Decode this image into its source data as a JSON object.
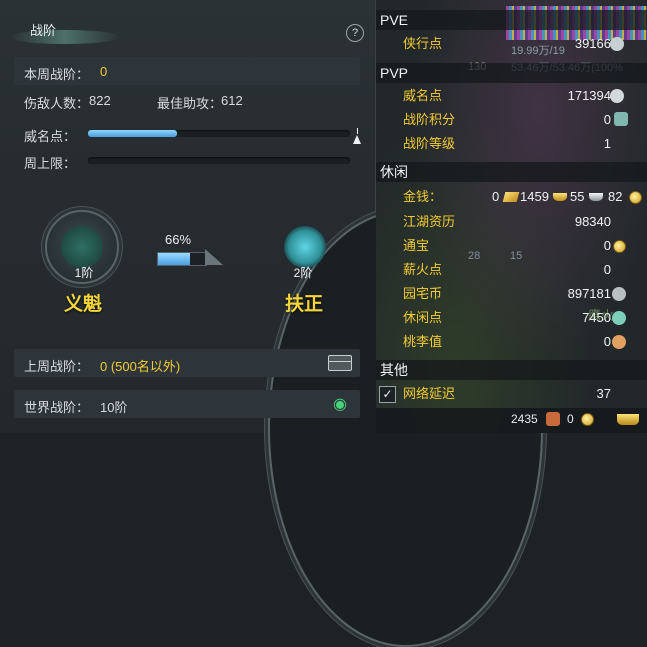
{
  "left_panel": {
    "tab_label": "战阶",
    "help_label": "?",
    "this_week": {
      "label": "本周战阶：",
      "value": "0"
    },
    "enemies": {
      "label": "伤敌人数：",
      "value": "822"
    },
    "best_assist": {
      "label": "最佳助攻：",
      "value": "612"
    },
    "reputation": {
      "label": "威名点：",
      "fill_fraction": 0.34
    },
    "weekly_cap": {
      "label": "周上限：",
      "fill_fraction": 0.0
    },
    "rank_current": {
      "level": "1阶",
      "name": "义魁"
    },
    "rank_next": {
      "level": "2阶",
      "name": "扶正"
    },
    "progress": {
      "text": "66%",
      "fraction": 0.66
    },
    "last_week": {
      "label": "上周战阶：",
      "value": "0 (500名以外)"
    },
    "world": {
      "label": "世界战阶：",
      "value": "10阶"
    }
  },
  "right_panel": {
    "hud_fragments": {
      "sub1": "19.99万/19",
      "sub2": "53.46万/53.46万(100%",
      "level_badge": "130",
      "num28": "28",
      "num15": "15",
      "faded_text": "鹰火"
    },
    "sections": {
      "pve": {
        "header": "PVE",
        "items": [
          {
            "label": "侠行点",
            "value": "39166"
          }
        ]
      },
      "pvp": {
        "header": "PVP",
        "items": [
          {
            "label": "威名点",
            "value": "171394"
          },
          {
            "label": "战阶积分",
            "value": "0"
          },
          {
            "label": "战阶等级",
            "value": "1"
          }
        ]
      },
      "leisure": {
        "header": "休闲",
        "money_label": "金钱：",
        "money_values": {
          "a": "0",
          "b": "1459",
          "c": "55",
          "d": "82"
        },
        "items": [
          {
            "label": "江湖资历",
            "value": "98340"
          },
          {
            "label": "通宝",
            "value": "0"
          },
          {
            "label": "薪火点",
            "value": "0"
          },
          {
            "label": "园宅币",
            "value": "897181"
          },
          {
            "label": "休闲点",
            "value": "7450"
          },
          {
            "label": "桃李值",
            "value": "0"
          }
        ]
      },
      "other": {
        "header": "其他",
        "latency_label": "网络延迟",
        "latency_value": "37",
        "checkmark": "✓"
      }
    },
    "bottom": {
      "num1": "2435",
      "num2": "0"
    }
  },
  "colors": {
    "accent_yellow": "#f2cc34",
    "bar_blue": "#4a9fdc",
    "panel_bg": "#262c30"
  },
  "icons": [
    "help-icon",
    "leaf-ornament",
    "chest-icon",
    "map-pin-icon",
    "coin-icon",
    "ingot-icon",
    "checkbox-icon"
  ]
}
